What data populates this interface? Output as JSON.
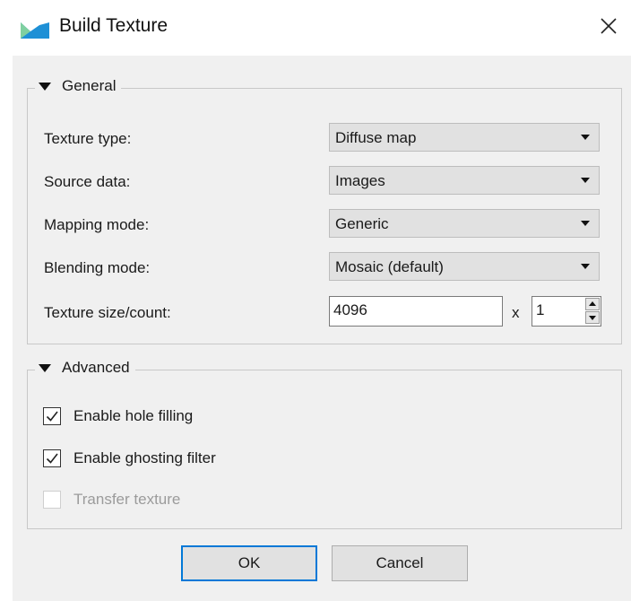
{
  "window": {
    "title": "Build Texture",
    "close_icon": "close-icon",
    "app_icon": "build-texture-app-icon"
  },
  "general": {
    "header": "General",
    "texture_type": {
      "label": "Texture type:",
      "value": "Diffuse map"
    },
    "source_data": {
      "label": "Source data:",
      "value": "Images"
    },
    "mapping_mode": {
      "label": "Mapping mode:",
      "value": "Generic"
    },
    "blending_mode": {
      "label": "Blending mode:",
      "value": "Mosaic (default)"
    },
    "texture_size_count": {
      "label": "Texture size/count:",
      "size": "4096",
      "separator": "x",
      "count": "1"
    }
  },
  "advanced": {
    "header": "Advanced",
    "options": [
      {
        "label": "Enable hole filling",
        "checked": true,
        "enabled": true
      },
      {
        "label": "Enable ghosting filter",
        "checked": true,
        "enabled": true
      },
      {
        "label": "Transfer texture",
        "checked": false,
        "enabled": false
      }
    ]
  },
  "buttons": {
    "ok": "OK",
    "cancel": "Cancel"
  },
  "colors": {
    "accent": "#0078d7",
    "dialog_bg": "#f0f0f0",
    "combo_bg": "#e1e1e1"
  }
}
